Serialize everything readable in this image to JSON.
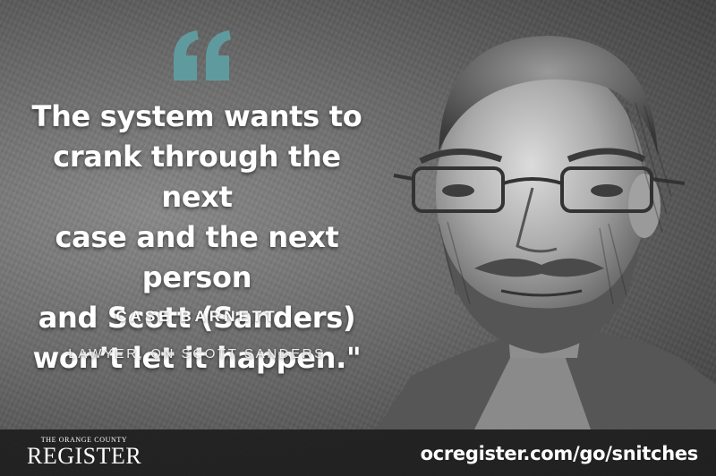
{
  "quote": {
    "text": "The system wants to\ncrank through the next\ncase and the next person\nand Scott (Sanders)\nwon’t let it happen.\"",
    "mark_color": "#5f9b9e"
  },
  "speaker": {
    "name": "CASE BARNETT",
    "role": "LAWYER, ON SCOTT SANDERS"
  },
  "footer": {
    "logo_small": "THE ORANGE COUNTY",
    "logo_main": "REGISTER",
    "url": "ocregister.com/go/snitches"
  },
  "illustration": {
    "subject": "sketch-portrait-icon"
  }
}
